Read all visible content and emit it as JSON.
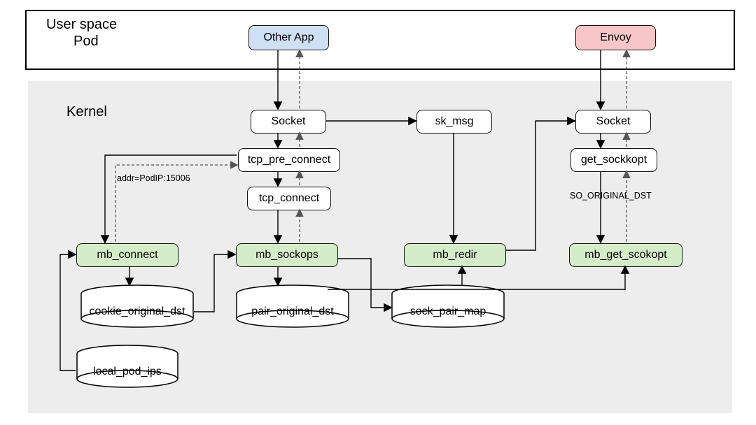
{
  "userspace": {
    "title1": "User space",
    "title2": "Pod"
  },
  "apps": {
    "other": "Other App",
    "envoy": "Envoy"
  },
  "kernel": {
    "title": "Kernel",
    "socket_l": "Socket",
    "sk_msg": "sk_msg",
    "socket_r": "Socket",
    "tcp_pre": "tcp_pre_connect",
    "tcp_conn": "tcp_connect",
    "get_sockopt": "get_sockkopt"
  },
  "bpf": {
    "mb_connect": "mb_connect",
    "mb_sockops": "mb_sockops",
    "mb_redir": "mb_redir",
    "mb_get_sockopt": "mb_get_scokopt"
  },
  "maps": {
    "cookie": "cookie_original_dst",
    "pair": "pair_original_dst",
    "sockpair": "sock_pair_map",
    "localpod": "local_pod_ips"
  },
  "notes": {
    "addr": "addr=PodIP:15006",
    "so": "SO_ORIGINAL_DST"
  },
  "colors": {
    "blue": "#cfe0f5",
    "pink": "#f7c6c6",
    "green": "#d4ecc8",
    "grey": "#ededed"
  }
}
